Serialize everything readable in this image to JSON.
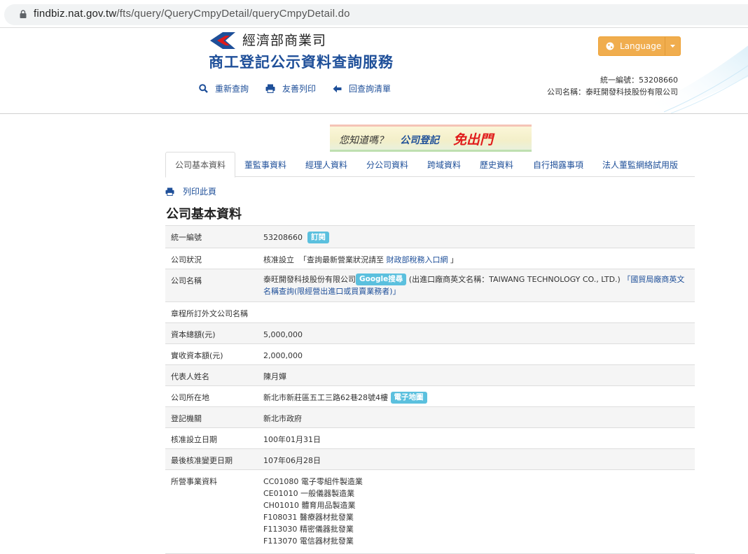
{
  "browser": {
    "url_host": "findbiz.nat.gov.tw",
    "url_path": "/fts/query/QueryCmpyDetail/queryCmpyDetail.do"
  },
  "header": {
    "ministry": "經濟部商業司",
    "service_title": "商工登記公示資料查詢服務",
    "nav": {
      "requery": "重新查詢",
      "print": "友善列印",
      "back": "回查詢清單"
    },
    "language_button": "Language",
    "id_line": "統一編號：53208660",
    "name_line": "公司名稱：泰旺開發科技股份有限公司"
  },
  "banner": {
    "question": "您知道嗎？",
    "registration": "公司登記",
    "free": "免出門"
  },
  "tabs": [
    "公司基本資料",
    "董監事資料",
    "經理人資料",
    "分公司資料",
    "跨域資料",
    "歷史資料",
    "自行揭露事項",
    "法人董監網絡試用版"
  ],
  "print_page": "列印此頁",
  "section_title": "公司基本資料",
  "rows": {
    "id": {
      "label": "統一編號",
      "value": "53208660",
      "badge": "訂閱"
    },
    "status": {
      "label": "公司狀況",
      "value": "核准設立",
      "note_pre": "「查詢最新營業狀況請至",
      "note_link": "財政部稅務入口網",
      "note_post": "」"
    },
    "name": {
      "label": "公司名稱",
      "value": "泰旺開發科技股份有限公司",
      "badge": "Google搜尋",
      "en_pre": "(出進口廠商英文名稱：TAIWANG TECHNOLOGY CO., LTD.)",
      "en_link": "「國貿局廠商英文名稱查詢(限經營出進口或買賣業務者)」"
    },
    "foreign_name": {
      "label": "章程所訂外文公司名稱",
      "value": ""
    },
    "capital": {
      "label": "資本總額(元)",
      "value": "5,000,000"
    },
    "paid": {
      "label": "實收資本額(元)",
      "value": "2,000,000"
    },
    "rep": {
      "label": "代表人姓名",
      "value": "陳月嬋"
    },
    "address": {
      "label": "公司所在地",
      "value": "新北市新莊區五工三路62巷28號4樓",
      "badge": "電子地圖"
    },
    "authority": {
      "label": "登記機關",
      "value": "新北市政府"
    },
    "est_date": {
      "label": "核准設立日期",
      "value": "100年01月31日"
    },
    "change_date": {
      "label": "最後核准變更日期",
      "value": "107年06月28日"
    },
    "business": {
      "label": "所營事業資料",
      "items": [
        "CC01080 電子零組件製造業",
        "CE01010 一般儀器製造業",
        "CH01010 體育用品製造業",
        "F108031 醫療器材批發業",
        "F113030 精密儀器批發業",
        "F113070 電信器材批發業"
      ]
    }
  },
  "colors": {
    "link": "#1e4f99",
    "badge": "#5bc0de",
    "language_button": "#f0ad4e",
    "banner_red": "#e01b1b"
  }
}
